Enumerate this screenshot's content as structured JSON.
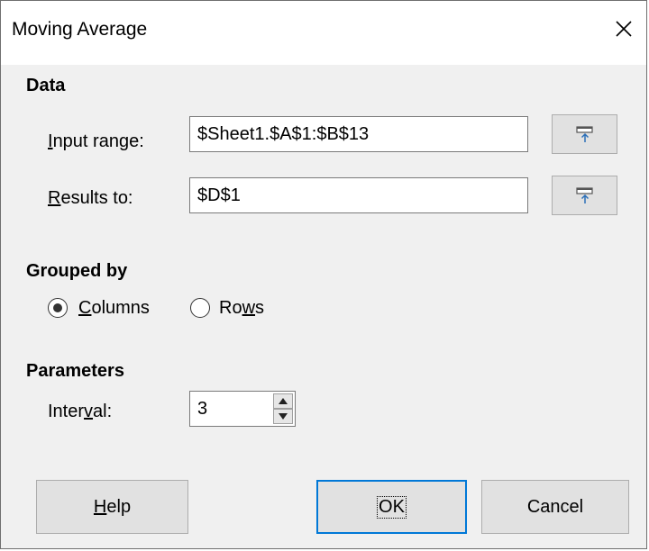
{
  "window": {
    "title": "Moving Average"
  },
  "data_section": {
    "heading": "Data",
    "input_range": {
      "label_underlined": "I",
      "label_rest": "nput range:",
      "value": "$Sheet1.$A$1:$B$13"
    },
    "results_to": {
      "label_underlined": "R",
      "label_rest": "esults to:",
      "value": "$D$1"
    },
    "shrink_icon": "shrink-range-icon"
  },
  "grouped_section": {
    "heading": "Grouped by",
    "columns": {
      "label_underlined": "C",
      "label_rest": "olumns",
      "selected": true
    },
    "rows": {
      "label_prefix": "Ro",
      "label_underlined": "w",
      "label_rest": "s",
      "selected": false
    }
  },
  "parameters_section": {
    "heading": "Parameters",
    "interval": {
      "label_prefix": "Inter",
      "label_underlined": "v",
      "label_rest": "al:",
      "value": "3"
    }
  },
  "buttons": {
    "help": {
      "label_underlined": "H",
      "label_rest": "elp"
    },
    "ok": {
      "label": "OK"
    },
    "cancel": {
      "label": "Cancel"
    }
  }
}
